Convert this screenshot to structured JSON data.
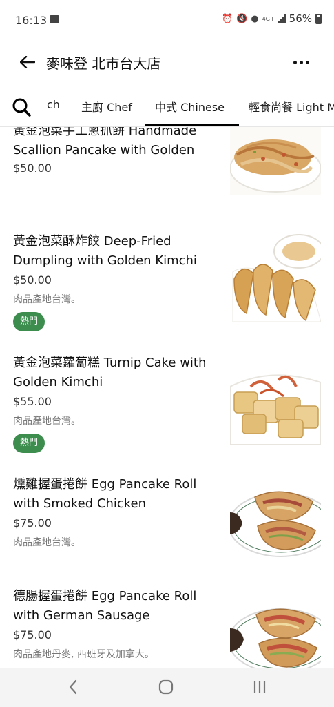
{
  "status": {
    "time": "16:13",
    "network": "4G+",
    "battery": "56%"
  },
  "header": {
    "title": "麥味登 北市台大店"
  },
  "tabs": [
    {
      "label": "ch"
    },
    {
      "label": "主廚 Chef"
    },
    {
      "label": "中式 Chinese"
    },
    {
      "label": "輕食尚餐 Light M"
    }
  ],
  "items": [
    {
      "name": "黃金泡菜手工蔥抓餅 Handmade Scallion Pancake with Golden",
      "price": "$50.00"
    },
    {
      "name": "黃金泡菜酥炸餃 Deep-Fried Dumpling with Golden Kimchi",
      "price": "$50.00",
      "desc": "肉品產地台灣。",
      "badge": "熱門"
    },
    {
      "name": "黃金泡菜蘿蔔糕 Turnip Cake with Golden Kimchi",
      "price": "$55.00",
      "desc": "肉品產地台灣。",
      "badge": "熱門"
    },
    {
      "name": "燻雞握蛋捲餅 Egg Pancake Roll with Smoked Chicken",
      "price": "$75.00",
      "desc": "肉品產地台灣。"
    },
    {
      "name": "德腸握蛋捲餅 Egg Pancake Roll with German Sausage",
      "price": "$75.00",
      "desc": "肉品產地丹麥, 西班牙及加拿大。"
    }
  ],
  "colors": {
    "badge": "#3d8d4f",
    "active_tab_underline": "#000000"
  }
}
